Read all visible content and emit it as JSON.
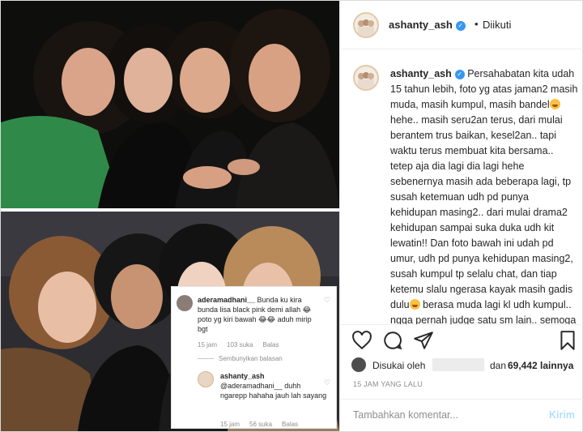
{
  "post": {
    "author": "ashanty_ash",
    "dot": "•",
    "follow_status": "Diikuti"
  },
  "caption": {
    "username": "ashanty_ash",
    "text_1": "Persahabatan kita udah 15 tahun lebih, foto yg atas jaman2 masih muda, masih kumpul, masih bandel",
    "text_2": " hehe.. masih seru2an terus, dari mulai berantem trus baikan, kesel2an.. tapi waktu terus membuat kita bersama.. tetep aja dia lagi dia lagi hehe sebenernya masih ada beberapa lagi, tp susah ketemuan udh pd punya kehidupan masing2.. dari mulai drama2 kehidupan sampai suka duka udh kit lewatin!! Dan foto bawah ini udah pd umur, udh pd punya kehidupan masing2, susah kumpul tp selalu chat, dan tiap ketemu slalu ngerasa kayak masih gadis dulu",
    "text_3": " berasa muda lagi kl udh kumpul.. ngga pernah judge satu sm lain.. semoga kita selalu punya waktu untuk"
  },
  "likes": {
    "prefix": "Disukai oleh",
    "and_word": "dan",
    "count": "69,442 lainnya"
  },
  "timestamp": "15 JAM YANG LALU",
  "comment_box": {
    "placeholder": "Tambahkan komentar...",
    "post_label": "Kirim"
  },
  "overlay": {
    "comment_1": {
      "username": "aderamadhani__",
      "text": " Bunda ku kira bunda lisa black pink demi allah 😂 poto yg kiri bawah 😂😂 aduh mirip bgt",
      "time": "15 jam",
      "likes": "103 suka",
      "reply": "Balas",
      "hide_replies": "Sembunyikan balasan"
    },
    "comment_2": {
      "username": "ashanty_ash",
      "text": "@aderamadhani__ duhh ngarepp hahaha jauh lah sayang",
      "time": "15 jam",
      "likes": "56 suka",
      "reply": "Balas"
    }
  },
  "icons": [
    "heart-icon",
    "comment-icon",
    "share-icon",
    "bookmark-icon",
    "verified-icon"
  ],
  "colors": {
    "link_blue": "#3897f0",
    "muted": "#8e8e8e",
    "post_disabled": "#b2dffc"
  }
}
